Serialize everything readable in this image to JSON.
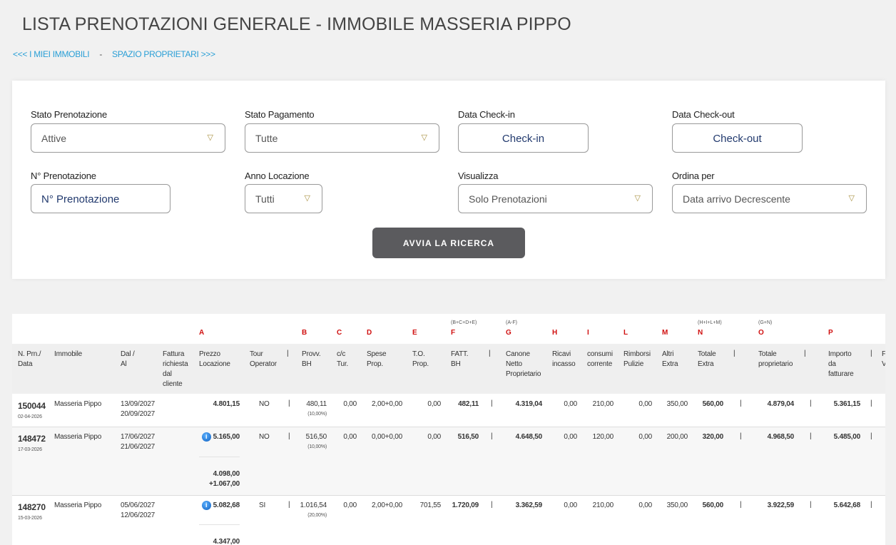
{
  "page": {
    "title": "LISTA PRENOTAZIONI GENERALE - IMMOBILE MASSERIA PIPPO",
    "link_back": "<<< I MIEI IMMOBILI",
    "link_sep": "-",
    "link_owner": "SPAZIO PROPRIETARI >>>"
  },
  "filters": {
    "stato_prenotazione": {
      "label": "Stato Prenotazione",
      "value": "Attive"
    },
    "stato_pagamento": {
      "label": "Stato Pagamento",
      "value": "Tutte"
    },
    "checkin": {
      "label": "Data Check-in",
      "placeholder": "Check-in"
    },
    "checkout": {
      "label": "Data Check-out",
      "placeholder": "Check-out"
    },
    "n_prenotazione": {
      "label": "N° Prenotazione",
      "placeholder": "N° Prenotazione"
    },
    "anno_locazione": {
      "label": "Anno Locazione",
      "value": "Tutti"
    },
    "visualizza": {
      "label": "Visualizza",
      "value": "Solo Prenotazioni"
    },
    "ordina": {
      "label": "Ordina per",
      "value": "Data arrivo Decrescente"
    },
    "search_label": "AVVIA LA RICERCA"
  },
  "table": {
    "formulas": {
      "F": "(B+C+D+E)",
      "G": "(A-F)",
      "N": "(H+I+L+M)",
      "O": "(G+N)"
    },
    "letters": {
      "A": "A",
      "B": "B",
      "C": "C",
      "D": "D",
      "E": "E",
      "F": "F",
      "G": "G",
      "H": "H",
      "I": "I",
      "L": "L",
      "M": "M",
      "N": "N",
      "O": "O",
      "P": "P"
    },
    "headers": {
      "nprn": [
        "N. Prn./",
        "Data"
      ],
      "immobile": [
        "Immobile"
      ],
      "dal": [
        "Dal /",
        "Al"
      ],
      "fattura": [
        "Fattura",
        "richiesta",
        "dal",
        "cliente"
      ],
      "prezzo": [
        "Prezzo",
        "Locazione"
      ],
      "tour": [
        "Tour",
        "Operator"
      ],
      "provv": [
        "Provv.",
        "BH"
      ],
      "cc": [
        "c/c",
        "Tur."
      ],
      "spese": [
        "Spese",
        "Prop."
      ],
      "to": [
        "T.O.",
        "Prop."
      ],
      "fatt": [
        "FATT.",
        "BH"
      ],
      "canone": [
        "Canone",
        "Netto",
        "Proprietario"
      ],
      "ricavi": [
        "Ricavi",
        "incasso"
      ],
      "consumi": [
        "consumi",
        "corrente"
      ],
      "rimborsi": [
        "Rimborsi",
        "Pulizie"
      ],
      "altri": [
        "Altri",
        "Extra"
      ],
      "totextra": [
        "Totale",
        "Extra"
      ],
      "totprop": [
        "Totale",
        "proprietario"
      ],
      "importo": [
        "Importo",
        "da",
        "fatturare"
      ],
      "cut": [
        "F",
        "V"
      ]
    },
    "pipe": "|",
    "info_glyph": "i",
    "rows": [
      {
        "nprn": "150044",
        "data": "02-04-2026",
        "immobile": "Masseria Pippo",
        "dal": "13/09/2027",
        "al": "20/09/2027",
        "prezzo": "4.801,15",
        "info": false,
        "tour": "NO",
        "provv": "480,11",
        "provv_pct": "(10,00%)",
        "cc": "0,00",
        "spese": "2,00+0,00",
        "to": "0,00",
        "fatt": "482,11",
        "canone": "4.319,04",
        "ricavi": "0,00",
        "consumi": "210,00",
        "rimborsi": "0,00",
        "altri": "350,00",
        "totextra": "560,00",
        "totprop": "4.879,04",
        "importo": "5.361,15"
      },
      {
        "nprn": "148472",
        "data": "17-03-2026",
        "immobile": "Masseria Pippo",
        "dal": "17/06/2027",
        "al": "21/06/2027",
        "prezzo": "5.165,00",
        "info": true,
        "prezzo_split_a": "4.098,00",
        "prezzo_split_b": "+1.067,00",
        "tour": "NO",
        "provv": "516,50",
        "provv_pct": "(10,00%)",
        "cc": "0,00",
        "spese": "0,00+0,00",
        "to": "0,00",
        "fatt": "516,50",
        "canone": "4.648,50",
        "ricavi": "0,00",
        "consumi": "120,00",
        "rimborsi": "0,00",
        "altri": "200,00",
        "totextra": "320,00",
        "totprop": "4.968,50",
        "importo": "5.485,00"
      },
      {
        "nprn": "148270",
        "data": "15-03-2026",
        "immobile": "Masseria Pippo",
        "dal": "05/06/2027",
        "al": "12/06/2027",
        "prezzo": "5.082,68",
        "info": true,
        "prezzo_split_a": "4.347,00",
        "tour": "SI",
        "provv": "1.016,54",
        "provv_pct": "(20,00%)",
        "cc": "0,00",
        "spese": "2,00+0,00",
        "to": "701,55",
        "fatt": "1.720,09",
        "canone": "3.362,59",
        "ricavi": "0,00",
        "consumi": "210,00",
        "rimborsi": "0,00",
        "altri": "350,00",
        "totextra": "560,00",
        "totprop": "3.922,59",
        "importo": "5.642,68"
      }
    ]
  }
}
